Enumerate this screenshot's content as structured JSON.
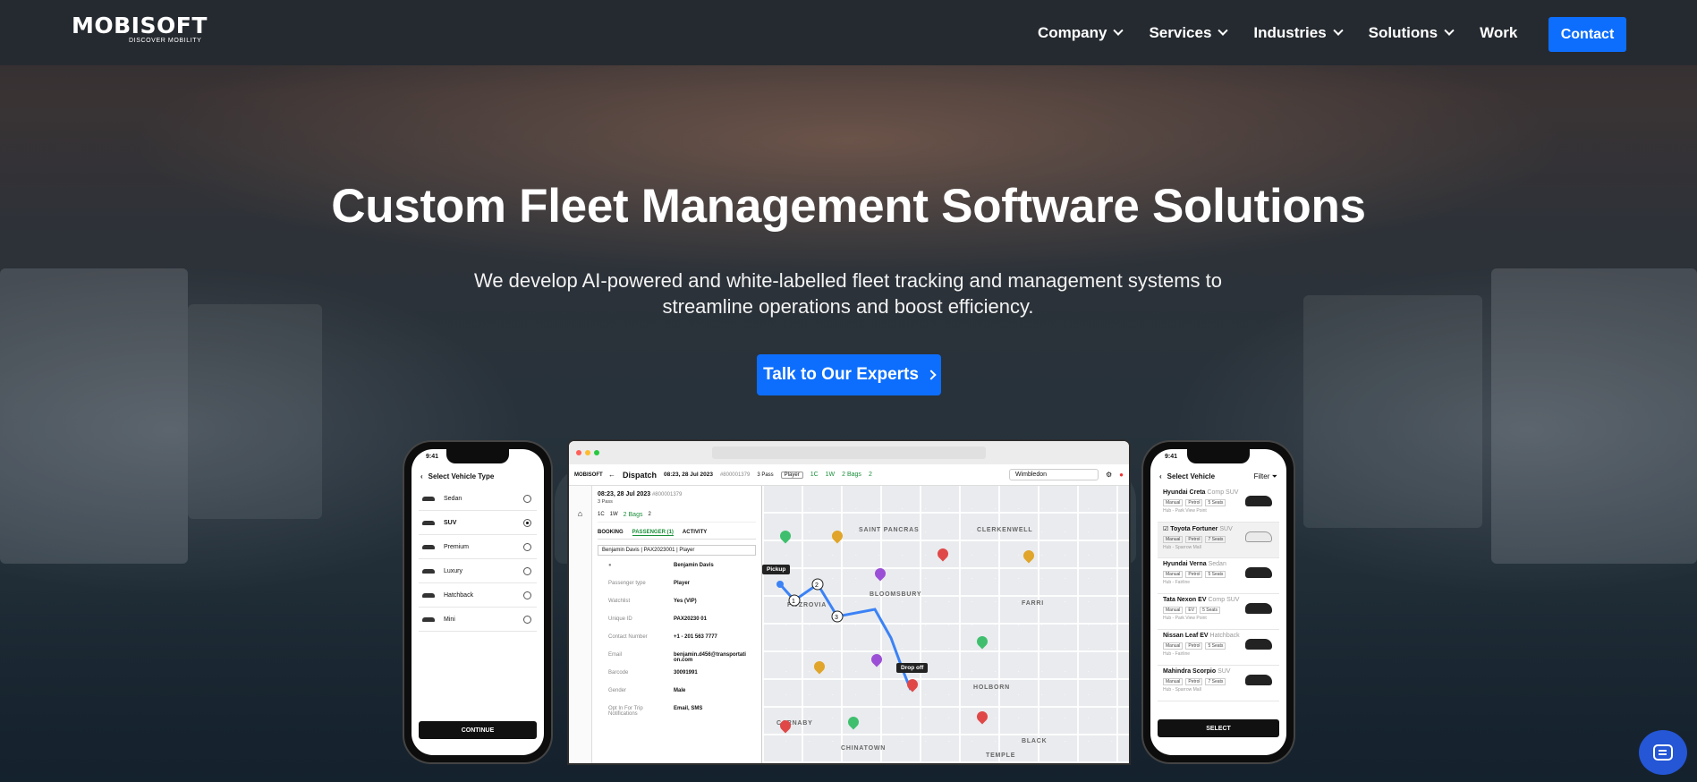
{
  "header": {
    "logo": {
      "word": "MOBISOFT",
      "tagline": "DISCOVER MOBILITY"
    },
    "nav": [
      {
        "label": "Company",
        "has_dropdown": true
      },
      {
        "label": "Services",
        "has_dropdown": true
      },
      {
        "label": "Industries",
        "has_dropdown": true
      },
      {
        "label": "Solutions",
        "has_dropdown": true
      },
      {
        "label": "Work",
        "has_dropdown": false
      }
    ],
    "contact_label": "Contact"
  },
  "hero": {
    "title": "Custom Fleet Management Software Solutions",
    "subtitle_line1": "We develop AI-powered and white-labelled fleet tracking and management systems to",
    "subtitle_line2": "streamline operations and boost efficiency.",
    "cta_label": "Talk to Our Experts"
  },
  "left_phone": {
    "time": "9:41",
    "title": "Select Vehicle Type",
    "options": [
      "Sedan",
      "SUV",
      "Premium",
      "Luxury",
      "Hatchback",
      "Mini"
    ],
    "selected": "SUV",
    "button": "CONTINUE"
  },
  "dispatch": {
    "app_logo": "MOBISOFT",
    "title": "Dispatch",
    "datetime": "08:23, 28 Jul 2023",
    "ref": "#800001379",
    "pass": "3 Pass",
    "role_chip": "Player",
    "counts": [
      "1C",
      "1W",
      "2 Bags",
      "2"
    ],
    "location": "Wimbledon",
    "panel": {
      "head": "08:23, 28 Jul 2023",
      "head_ref": "#800001379",
      "sub": "3 Pass",
      "tabs": [
        "BOOKING",
        "PASSENGER (1)",
        "ACTIVITY"
      ],
      "active_tab": "PASSENGER (1)",
      "passenger_select": "Benjamin Davis | PAX2023001 | Player",
      "name": "Benjamin Davis",
      "fields": [
        {
          "k": "Passenger type",
          "v": "Player"
        },
        {
          "k": "Watchlist",
          "v": "Yes (VIP)"
        },
        {
          "k": "Unique ID",
          "v": "PAX20230 01"
        },
        {
          "k": "Contact Number",
          "v": "+1 - 201 563 7777"
        },
        {
          "k": "Email",
          "v": "benjamin.d456@transportati on.com"
        },
        {
          "k": "Barcode",
          "v": "30091991"
        },
        {
          "k": "Gender",
          "v": "Male"
        },
        {
          "k": "Opt In For Trip Notifications",
          "v": "Email, SMS"
        }
      ]
    },
    "map": {
      "labels": [
        "SAINT PANCRAS",
        "CLERKENWELL",
        "BLOOMSBURY",
        "FITZROVIA",
        "HOLBORN",
        "CHINATOWN",
        "CARNABY",
        "TEMPLE",
        "FARRI",
        "BLACK"
      ],
      "pickup": "Pickup",
      "dropoff": "Drop off",
      "stops": [
        "1",
        "2",
        "3"
      ]
    }
  },
  "right_phone": {
    "time": "9:41",
    "title": "Select Vehicle",
    "filter": "Filter",
    "vehicles": [
      {
        "name": "Hyundai Creta",
        "class": "Comp SUV",
        "tags": [
          "Manual",
          "Petrol",
          "5 Seats"
        ],
        "hub": "Hub - Park View Point"
      },
      {
        "name": "Toyota Fortuner",
        "class": "SUV",
        "tags": [
          "Manual",
          "Petrol",
          "7 Seats"
        ],
        "hub": "Hub - Sparrow Mall"
      },
      {
        "name": "Hyundai Verna",
        "class": "Sedan",
        "tags": [
          "Manual",
          "Petrol",
          "5 Seats"
        ],
        "hub": "Hub - Fairline"
      },
      {
        "name": "Tata Nexon EV",
        "class": "Comp SUV",
        "tags": [
          "Manual",
          "EV",
          "5 Seats"
        ],
        "hub": "Hub - Park View Point"
      },
      {
        "name": "Nissan Leaf EV",
        "class": "Hatchback",
        "tags": [
          "Manual",
          "Petrol",
          "5 Seats"
        ],
        "hub": "Hub - Fairline"
      },
      {
        "name": "Mahindra Scorpio",
        "class": "SUV",
        "tags": [
          "Manual",
          "Petrol",
          "7 Seats"
        ],
        "hub": "Hub - Sparrow Mall"
      }
    ],
    "selected": "Toyota Fortuner",
    "button": "SELECT"
  },
  "colors": {
    "accent": "#0d6efd",
    "header_bg": "#252a30",
    "chat": "#2456d6"
  },
  "icons": {
    "chat": "chat-icon",
    "nav_chevron": "chevron-down-icon",
    "cta_arrow": "chevron-right-icon"
  }
}
